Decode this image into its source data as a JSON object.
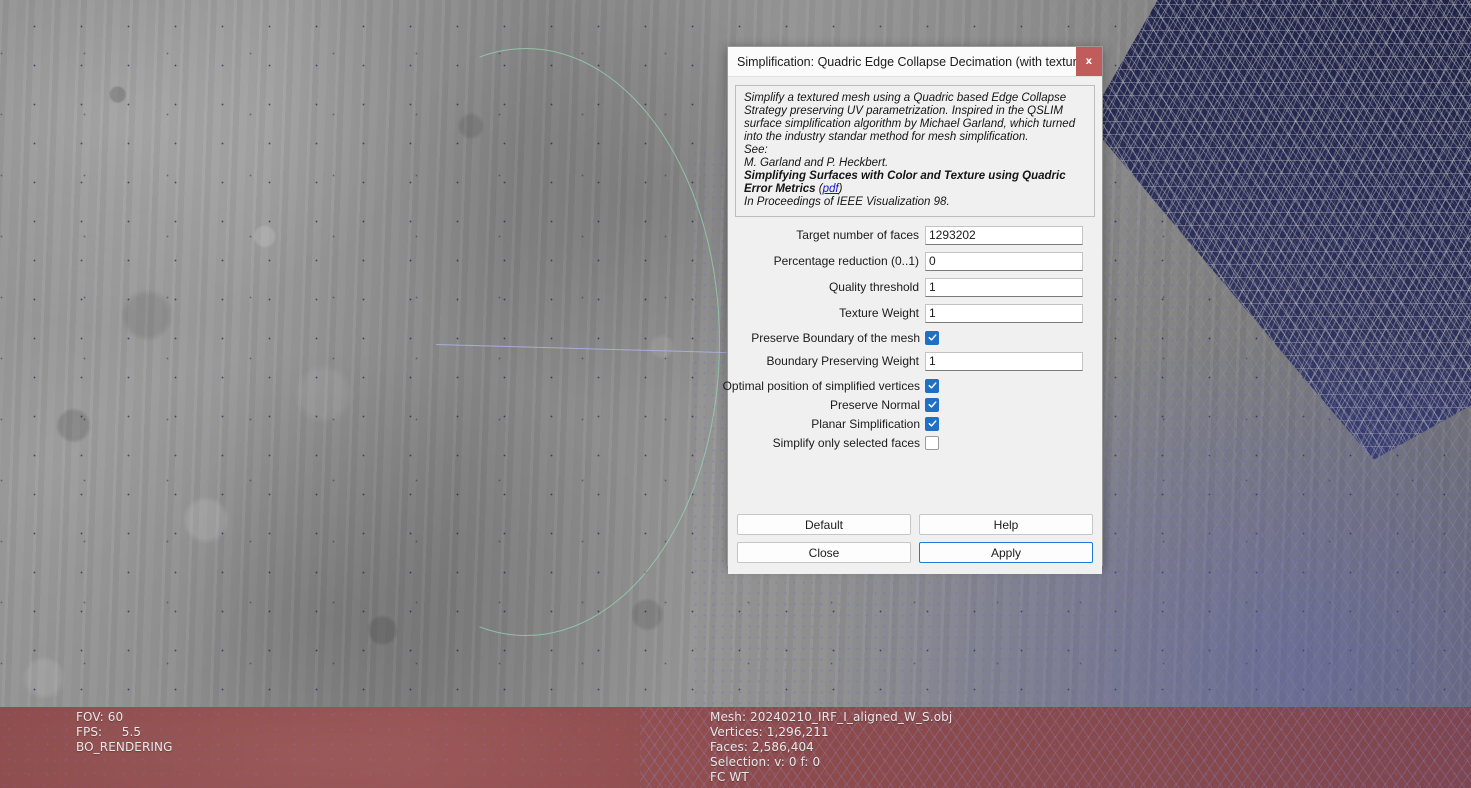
{
  "viewport": {
    "render_stats": "FOV: 60\nFPS:     5.5\nBO_RENDERING",
    "mesh_stats": "Mesh: 20240210_IRF_I_aligned_W_S.obj\nVertices: 1,296,211\nFaces: 2,586,404\nSelection: v: 0 f: 0\nFC WT",
    "colors": {
      "surface_grey": "#8f8f8f",
      "wireframe_navy": "#23254a",
      "bottom_band_red": "#8e4c4c",
      "trackball_green": "#96dcb4",
      "trackball_blue": "#afb9f0"
    }
  },
  "dialog": {
    "title": "Simplification: Quadric Edge Collapse Decimation (with texture)",
    "close_label": "x",
    "description": {
      "line1": "Simplify a textured mesh using a Quadric based Edge Collapse Strategy preserving UV parametrization. Inspired in the QSLIM surface simplification algorithm by Michael Garland, which turned into the industry standar method for mesh simplification.",
      "line2": "See:",
      "line3": "M. Garland and P. Heckbert.",
      "line4_bold": "Simplifying Surfaces with Color and Texture using Quadric Error Metrics",
      "link_label": "pdf",
      "line5": "In Proceedings of IEEE Visualization 98."
    },
    "fields": [
      {
        "label": "Target number of faces",
        "value": "1293202"
      },
      {
        "label": "Percentage reduction (0..1)",
        "value": "0"
      },
      {
        "label": "Quality threshold",
        "value": "1"
      },
      {
        "label": "Texture Weight",
        "value": "1"
      }
    ],
    "boundary_weight": {
      "label": "Boundary Preserving Weight",
      "value": "1"
    },
    "checks": [
      {
        "label": "Preserve Boundary of the mesh",
        "checked": true
      },
      {
        "label": "Optimal position of simplified vertices",
        "checked": true
      },
      {
        "label": "Preserve Normal",
        "checked": true
      },
      {
        "label": "Planar Simplification",
        "checked": true
      },
      {
        "label": "Simplify only selected faces",
        "checked": false
      }
    ],
    "buttons": {
      "default_label": "Default",
      "help_label": "Help",
      "close_label": "Close",
      "apply_label": "Apply"
    },
    "accent_color": "#1f7ad4",
    "close_color": "#c05c5c"
  }
}
